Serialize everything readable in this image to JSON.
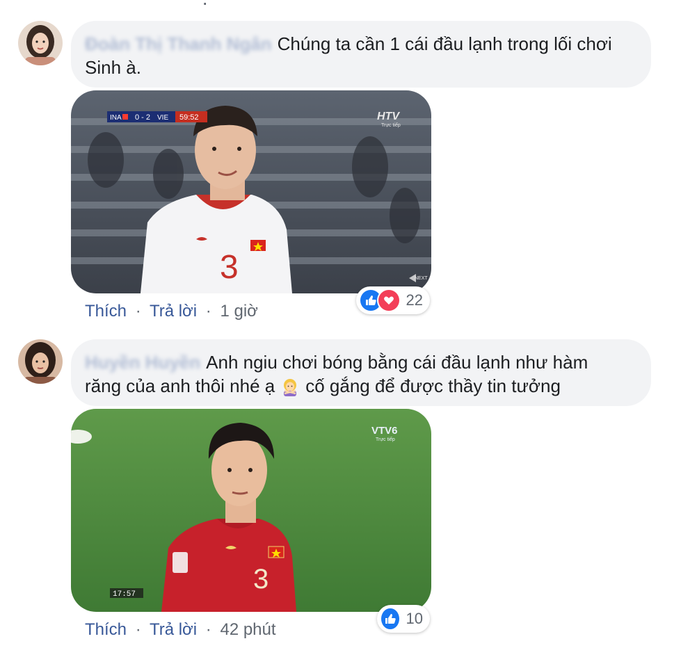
{
  "comments": [
    {
      "author": "Đoàn Thị Thanh Ngân",
      "text_line1": "Chúng ta cần 1 cái đầu lạnh trong lối chơi",
      "text_line2": "Sinh à.",
      "photo": {
        "score_left": "INA",
        "score": "0 - 2",
        "score_right": "VIE",
        "clock": "59:52",
        "broadcaster": "HTV",
        "broadcaster_sub": "Trực tiếp",
        "jersey_number": "3",
        "corner_label": "NEXT"
      },
      "actions": {
        "like": "Thích",
        "reply": "Trả lời",
        "sep": "·",
        "time": "1 giờ"
      },
      "reaction_count": "22",
      "reactions": [
        "like-icon",
        "love-icon"
      ]
    },
    {
      "author": "Huyền Huyền",
      "text_part1": "Anh ngiu chơi bóng bằng cái đầu lạnh như hàm",
      "text_part2": "răng của anh thôi nhé ạ",
      "text_part3": "cố gắng để được thầy tin tưởng",
      "photo": {
        "broadcaster": "VTV6",
        "broadcaster_sub": "Trực tiếp",
        "clock": "17:57",
        "jersey_number": "3"
      },
      "actions": {
        "like": "Thích",
        "reply": "Trả lời",
        "sep": "·",
        "time": "42 phút"
      },
      "reaction_count": "10",
      "reactions": [
        "like-icon"
      ]
    }
  ],
  "colors": {
    "link": "#385898",
    "bubble": "#f2f3f5",
    "like": "#1877f2",
    "love": "#f33e58"
  }
}
